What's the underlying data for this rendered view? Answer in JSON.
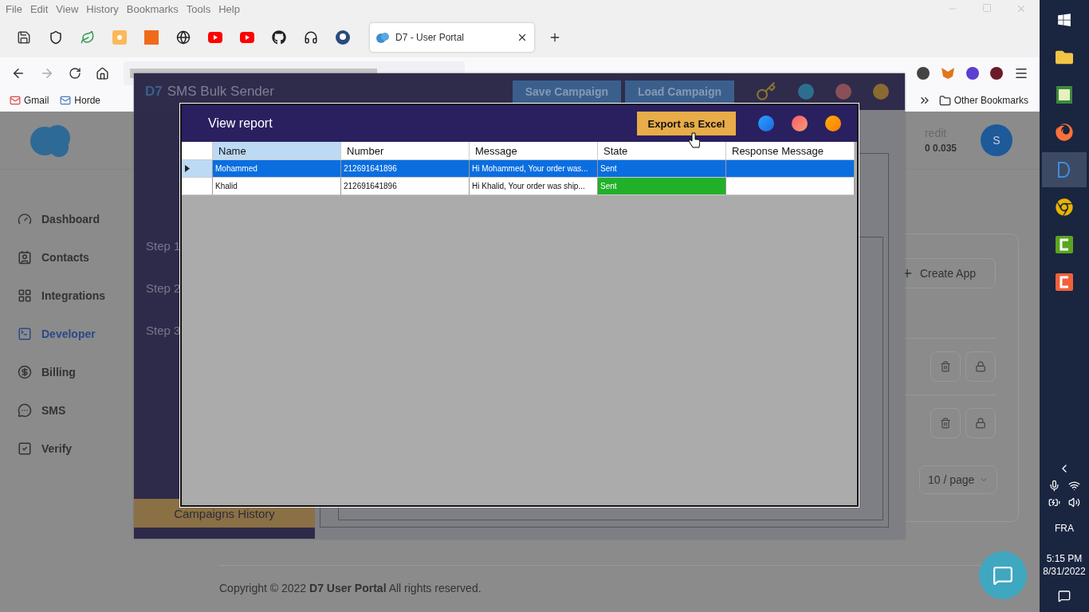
{
  "browser": {
    "menu": [
      "File",
      "Edit",
      "View",
      "History",
      "Bookmarks",
      "Tools",
      "Help"
    ],
    "tab": {
      "title": "D7 - User Portal",
      "selected": true
    },
    "bookmarks": [
      "Gmail",
      "Horde"
    ],
    "other_bookmarks": "Other Bookmarks"
  },
  "page": {
    "nav": [
      {
        "label": "Dashboard",
        "selected": false
      },
      {
        "label": "Contacts",
        "selected": false
      },
      {
        "label": "Integrations",
        "selected": false
      },
      {
        "label": "Developer",
        "selected": true
      },
      {
        "label": "Billing",
        "selected": false
      },
      {
        "label": "SMS",
        "selected": false
      },
      {
        "label": "Verify",
        "selected": false
      }
    ],
    "credit_label": "redit",
    "credit_value": "0 0.035",
    "avatar": "S",
    "create_button": "Create App",
    "page_size": "10 / page",
    "footer": "Copyright © 2022 **D7 User Portal** All rights reserved."
  },
  "app": {
    "logo": "D7",
    "title": "SMS Bulk Sender",
    "buttons": [
      "Save Campaign",
      "Load Campaign"
    ],
    "steps": [
      "Step 1",
      "Step 2",
      "Step 3"
    ],
    "history": "Campaigns History"
  },
  "dialog": {
    "title": "View report",
    "export": "Export as Excel",
    "columns": [
      {
        "label": "Name",
        "selected": true
      },
      {
        "label": "Number",
        "selected": false
      },
      {
        "label": "Message",
        "selected": false
      },
      {
        "label": "State",
        "selected": false
      },
      {
        "label": "Response Message",
        "selected": false
      }
    ],
    "rows": [
      {
        "name": "Mohammed",
        "number": "212691641896",
        "message": "Hi Mohammed, Your order was...",
        "state": "Sent",
        "selected": true
      },
      {
        "name": "Khalid",
        "number": "212691641896",
        "message": "Hi Khalid, Your order was ship...",
        "state": "Sent",
        "selected": false,
        "color": "#22b02a"
      }
    ]
  },
  "taskbar": {
    "apps": [
      {
        "selected": false
      },
      {
        "selected": false
      },
      {
        "selected": false
      },
      {
        "selected": false
      },
      {
        "selected": true
      },
      {
        "selected": false
      },
      {
        "selected": false
      },
      {
        "selected": false
      }
    ],
    "language": "FRA",
    "time": "5:15 PM",
    "date": "8/31/2022"
  }
}
